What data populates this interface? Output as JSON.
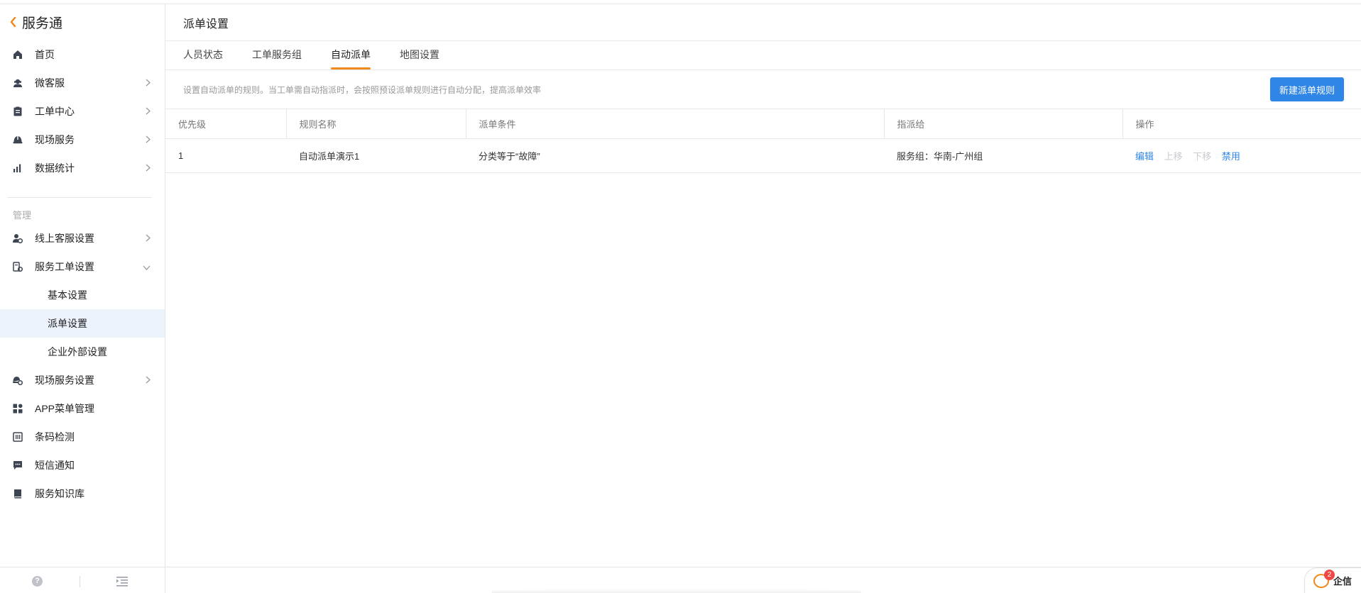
{
  "app": {
    "title": "服务通"
  },
  "sidebar": {
    "nav": [
      {
        "label": "首页",
        "icon": "home-icon"
      },
      {
        "label": "微客服",
        "icon": "customer-service-icon"
      },
      {
        "label": "工单中心",
        "icon": "clipboard-icon"
      },
      {
        "label": "现场服务",
        "icon": "helmet-icon"
      },
      {
        "label": "数据统计",
        "icon": "bar-chart-icon"
      }
    ],
    "section_label": "管理",
    "manage": [
      {
        "label": "线上客服设置",
        "icon": "person-gear-icon"
      },
      {
        "label": "服务工单设置",
        "icon": "ticket-gear-icon"
      },
      {
        "label": "基本设置"
      },
      {
        "label": "派单设置"
      },
      {
        "label": "企业外部设置"
      },
      {
        "label": "现场服务设置",
        "icon": "helmet-gear-icon"
      },
      {
        "label": "APP菜单管理",
        "icon": "app-grid-icon"
      },
      {
        "label": "条码检测",
        "icon": "barcode-icon"
      },
      {
        "label": "短信通知",
        "icon": "message-icon"
      },
      {
        "label": "服务知识库",
        "icon": "book-icon"
      }
    ]
  },
  "page": {
    "title": "派单设置",
    "tabs": [
      "人员状态",
      "工单服务组",
      "自动派单",
      "地图设置"
    ],
    "active_tab": "自动派单",
    "hint": "设置自动派单的规则。当工单需自动指派时，会按照预设派单规则进行自动分配，提高派单效率",
    "new_button": "新建派单规则"
  },
  "table": {
    "columns": [
      "优先级",
      "规则名称",
      "派单条件",
      "指派给",
      "操作"
    ],
    "rows": [
      {
        "priority": "1",
        "name": "自动派单演示1",
        "condition": "分类等于“故障”",
        "assignee": "服务组：华南-广州组",
        "actions": {
          "edit": "编辑",
          "up": "上移",
          "down": "下移",
          "disable": "禁用"
        }
      }
    ]
  },
  "widget": {
    "label": "企信",
    "badge": "2"
  },
  "colors": {
    "accent": "#f08a1d",
    "primary": "#2f86e6",
    "active_bg": "#edf3fd"
  }
}
